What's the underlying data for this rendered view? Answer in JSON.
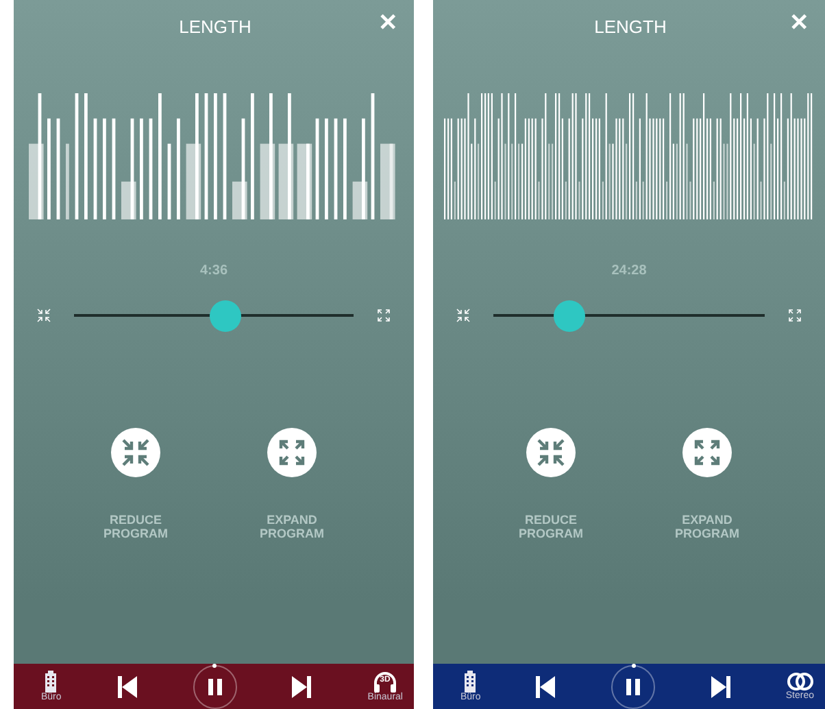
{
  "screens": [
    {
      "title": "LENGTH",
      "close": "✕",
      "time": "4:36",
      "level": 0.54,
      "reduce_label": "REDUCE PROGRAM",
      "expand_label": "EXPAND PROGRAM",
      "color": "#6a1020",
      "location_label": "Büro",
      "mode": {
        "kind": "headphones",
        "badge": "3D",
        "label": "Binaural"
      }
    },
    {
      "title": "LENGTH",
      "close": "✕",
      "time": "24:28",
      "level": 0.28,
      "reduce_label": "REDUCE PROGRAM",
      "expand_label": "EXPAND PROGRAM",
      "color": "#0e2c78",
      "location_label": "Büro",
      "mode": {
        "kind": "rings",
        "label": "Stereo"
      }
    }
  ]
}
